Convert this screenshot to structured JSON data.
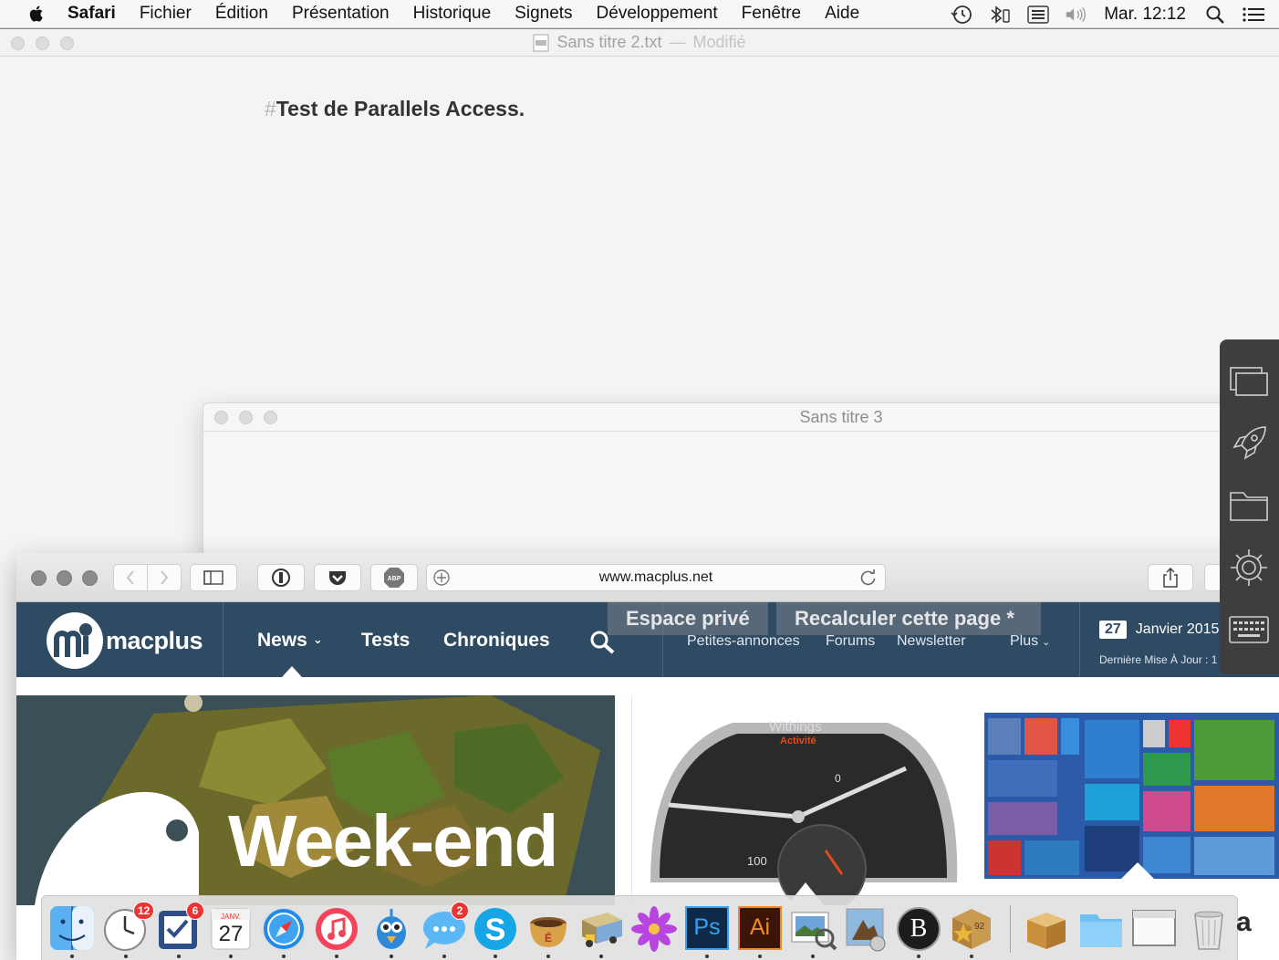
{
  "menubar": {
    "items": [
      "Safari",
      "Fichier",
      "Édition",
      "Présentation",
      "Historique",
      "Signets",
      "Développement",
      "Fenêtre",
      "Aide"
    ],
    "clock": "Mar. 12:12",
    "status_icons": [
      "time-machine-icon",
      "bluetooth-icon",
      "input-menu-icon",
      "volume-icon",
      "spotlight-icon",
      "notification-center-icon"
    ]
  },
  "editor": {
    "filename": "Sans titre 2.txt",
    "separator": "—",
    "status": "Modifié",
    "content_hash": "#",
    "content": "Test de Parallels Access."
  },
  "window3": {
    "title": "Sans titre 3"
  },
  "safari": {
    "url": "www.macplus.net",
    "site": {
      "logo_text": "macplus",
      "nav": [
        "News",
        "Tests",
        "Chroniques"
      ],
      "overlay_buttons": [
        "Espace privé",
        "Recalculer cette page *"
      ],
      "sublinks": [
        "Petites-annonces",
        "Forums",
        "Newsletter",
        "Plus"
      ],
      "date_day": "27",
      "date_month": "Janvier 2015",
      "last_update": "Dernière Mise À Jour : 1"
    },
    "tiles": {
      "hero_text": "Week-end",
      "watch_brand": "Withings",
      "watch_model": "Activité",
      "watch_num_0": "0",
      "watch_num_100": "100"
    }
  },
  "dock": {
    "apps": [
      {
        "name": "finder",
        "badge": ""
      },
      {
        "name": "clock",
        "badge": "12"
      },
      {
        "name": "reminders",
        "badge": "6"
      },
      {
        "name": "calendar",
        "badge": "",
        "month": "JANV.",
        "day": "27"
      },
      {
        "name": "safari",
        "badge": ""
      },
      {
        "name": "itunes",
        "badge": ""
      },
      {
        "name": "tweetbot",
        "badge": ""
      },
      {
        "name": "messages",
        "badge": "2"
      },
      {
        "name": "skype",
        "badge": ""
      },
      {
        "name": "coffee",
        "badge": ""
      },
      {
        "name": "transmit",
        "badge": ""
      },
      {
        "name": "flower",
        "badge": ""
      },
      {
        "name": "photoshop",
        "label": "Ps"
      },
      {
        "name": "illustrator",
        "label": "Ai"
      },
      {
        "name": "preview",
        "badge": ""
      },
      {
        "name": "eagle",
        "badge": ""
      },
      {
        "name": "bbedit",
        "label": "B"
      },
      {
        "name": "package",
        "label": "92"
      }
    ],
    "right_labels": [
      "a"
    ]
  },
  "colors": {
    "site_nav": "#2f4a63",
    "panel": "#3e3e3e",
    "badge": "#e33333",
    "ps": "#0f2a49",
    "ai": "#3b1608"
  }
}
